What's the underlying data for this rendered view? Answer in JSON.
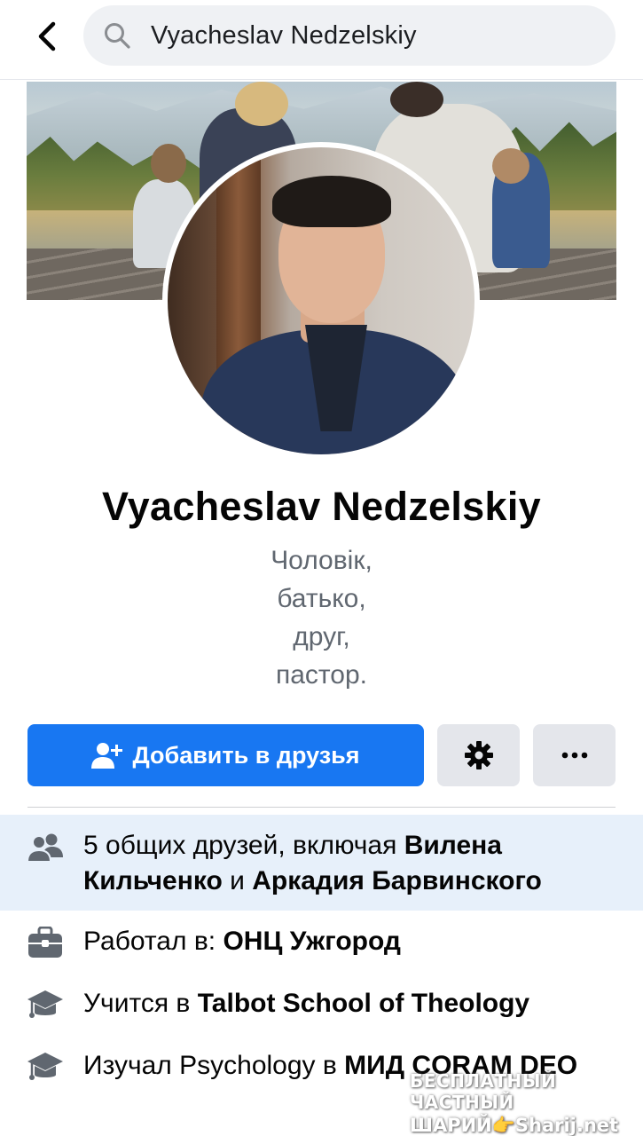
{
  "search": {
    "query": "Vyacheslav Nedzelskiy"
  },
  "profile": {
    "name": "Vyacheslav Nedzelskiy",
    "bio_lines": [
      "Чоловік,",
      "батько,",
      "друг,",
      "пастор."
    ]
  },
  "actions": {
    "add_friend_label": "Добавить в друзья",
    "settings_icon": "gear-icon",
    "more_icon": "more-icon"
  },
  "mutual_friends": {
    "prefix": "5 общих друзей, включая ",
    "friend1": "Вилена Кильченко",
    "connector": " и ",
    "friend2": "Аркадия Барвинского"
  },
  "details": {
    "work": {
      "prefix": "Работал в: ",
      "value": "ОНЦ Ужгород"
    },
    "study": {
      "prefix": "Учится в ",
      "value": "Talbot School of Theology"
    },
    "studied": {
      "prefix": "Изучал Psychology в ",
      "value": "МИД CORAM DEO"
    }
  },
  "watermark": {
    "line1": "БЕСПЛАТНЫЙ ЧАСТНЫЙ",
    "line2": "ШАРИЙ👉Sharij.net"
  },
  "colors": {
    "accent": "#1877f2",
    "highlight": "#e7f0fa",
    "button_gray": "#e4e6eb",
    "icon_gray": "#606770"
  }
}
